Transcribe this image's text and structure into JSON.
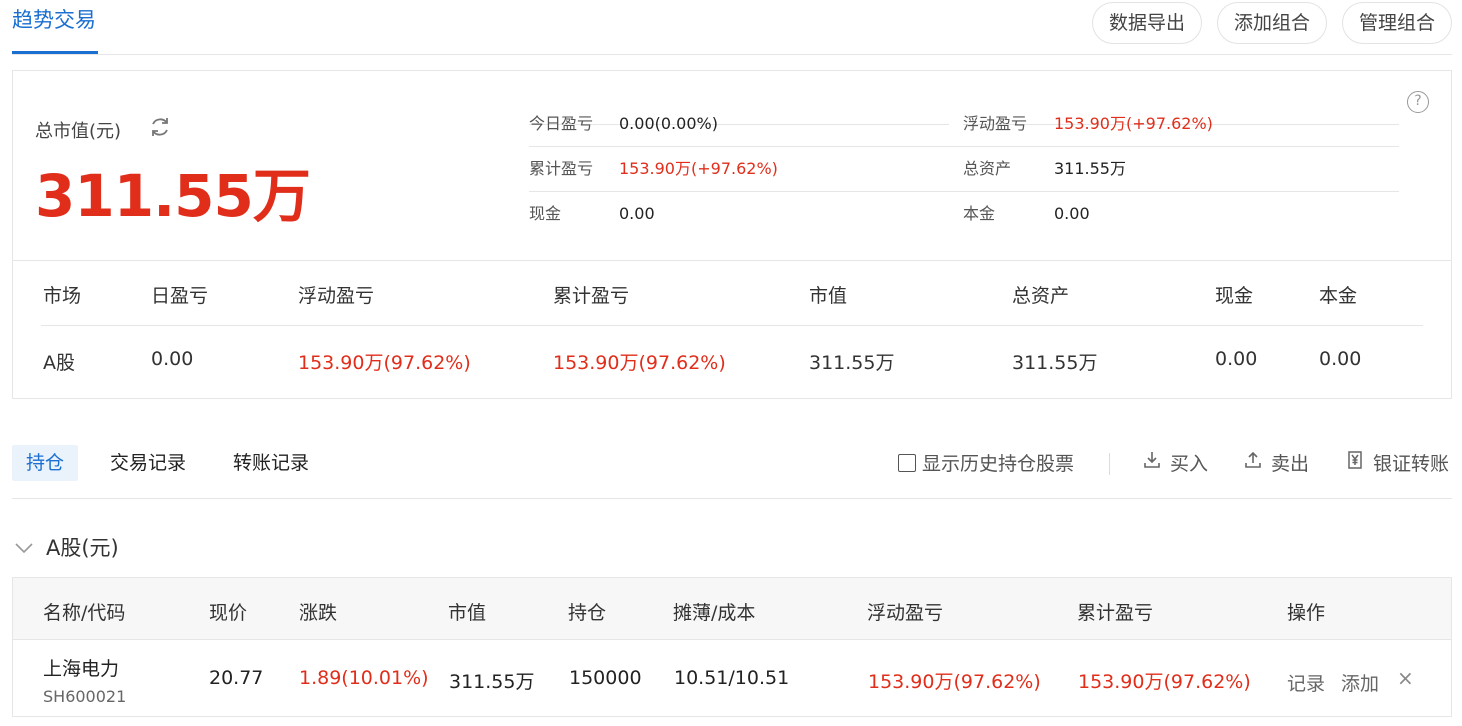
{
  "header": {
    "tab_label": "趋势交易",
    "buttons": [
      "数据导出",
      "添加组合",
      "管理组合"
    ]
  },
  "summary": {
    "total_value_label": "总市值(元)",
    "total_value": "311.55万",
    "help_icon": "?",
    "refresh_icon": "refresh-icon",
    "left": [
      {
        "k": "今日盈亏",
        "v": "0.00(0.00%)",
        "red": false
      },
      {
        "k": "累计盈亏",
        "v": "153.90万(+97.62%)",
        "red": true
      },
      {
        "k": "现金",
        "v": "0.00",
        "red": false
      }
    ],
    "right": [
      {
        "k": "浮动盈亏",
        "v": "153.90万(+97.62%)",
        "red": true
      },
      {
        "k": "总资产",
        "v": "311.55万",
        "red": false
      },
      {
        "k": "本金",
        "v": "0.00",
        "red": false
      }
    ]
  },
  "market_table": {
    "headers": [
      "市场",
      "日盈亏",
      "浮动盈亏",
      "累计盈亏",
      "市值",
      "总资产",
      "现金",
      "本金"
    ],
    "row": [
      "A股",
      "0.00",
      "153.90万(97.62%)",
      "153.90万(97.62%)",
      "311.55万",
      "311.55万",
      "0.00",
      "0.00"
    ]
  },
  "tabs": {
    "items": [
      "持仓",
      "交易记录",
      "转账记录"
    ],
    "show_history_label": "显示历史持仓股票",
    "actions": [
      {
        "icon": "download-icon",
        "label": "买入"
      },
      {
        "icon": "upload-icon",
        "label": "卖出"
      },
      {
        "icon": "yen-icon",
        "label": "银证转账"
      }
    ]
  },
  "section": {
    "title": "A股(元)"
  },
  "holdings": {
    "headers": [
      "名称/代码",
      "现价",
      "涨跌",
      "市值",
      "持仓",
      "摊薄/成本",
      "浮动盈亏",
      "累计盈亏",
      "操作"
    ],
    "rows": [
      {
        "name": "上海电力",
        "code": "SH600021",
        "price": "20.77",
        "change": "1.89(10.01%)",
        "value": "311.55万",
        "qty": "150000",
        "cost": "10.51/10.51",
        "float_pl": "153.90万(97.62%)",
        "total_pl": "153.90万(97.62%)",
        "ops": [
          "记录",
          "添加",
          "×"
        ]
      }
    ]
  },
  "colors": {
    "accent": "#1a6fd1",
    "up": "#e02e1b"
  }
}
